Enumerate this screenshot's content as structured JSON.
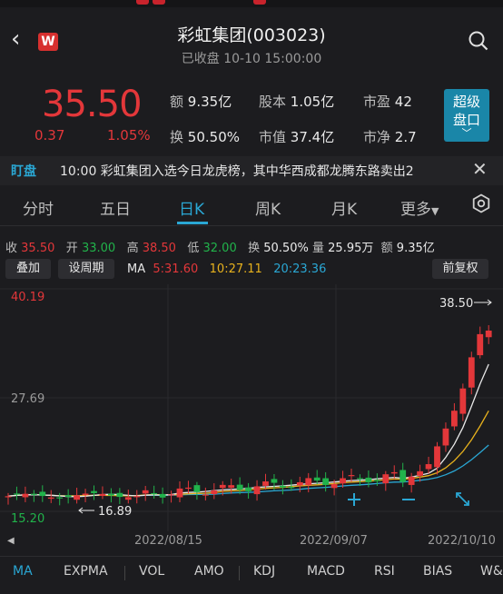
{
  "header": {
    "title": "彩虹集团(003023)",
    "subtitle": "已收盘 10-10 15:00:00",
    "logo_letter": "W"
  },
  "quote": {
    "price": "35.50",
    "change": "0.37",
    "change_pct": "1.05%",
    "stats": [
      {
        "label": "额",
        "value": "9.35亿"
      },
      {
        "label": "股本",
        "value": "1.05亿"
      },
      {
        "label": "市盈",
        "value": "42"
      },
      {
        "label": "换",
        "value": "50.50%"
      },
      {
        "label": "市值",
        "value": "37.4亿"
      },
      {
        "label": "市净",
        "value": "2.7"
      }
    ],
    "super_button": {
      "line1": "超级",
      "line2": "盘口",
      "chevron": "﹀"
    }
  },
  "news": {
    "tag": "盯盘",
    "text": "10:00 彩虹集团入选今日龙虎榜，其中华西成都龙腾东路卖出2"
  },
  "tabs": [
    "分时",
    "五日",
    "日K",
    "周K",
    "月K",
    "更多"
  ],
  "active_tab": "日K",
  "info_row": {
    "close_label": "收",
    "close": "35.50",
    "open_label": "开",
    "open": "33.00",
    "high_label": "高",
    "high": "38.50",
    "low_label": "低",
    "low": "32.00",
    "turnover_label": "换",
    "turnover": "50.50%",
    "volume_label": "量",
    "volume": "25.95万",
    "amount_label": "额",
    "amount": "9.35亿"
  },
  "controls": {
    "overlay": "叠加",
    "period": "设周期",
    "adjust": "前复权",
    "ma_label": "MA",
    "ma5": "5:31.60",
    "ma10": "10:27.11",
    "ma20": "20:23.36"
  },
  "chart_data": {
    "type": "candlestick",
    "y_ticks": [
      "40.19",
      "27.69",
      "15.20"
    ],
    "ylim": [
      15.2,
      40.19
    ],
    "high_marker": "38.50",
    "low_marker": "16.89",
    "x_labels": [
      "2022/08/15",
      "2022/09/07",
      "2022/10/10"
    ],
    "colors": {
      "up": "#e3373a",
      "down": "#21b34b",
      "ma5": "#e8e8e8",
      "ma10": "#e8b21d",
      "ma20": "#2aa7d4"
    }
  },
  "indicators": [
    "MA",
    "EXPMA",
    "VOL",
    "AMO",
    "KDJ",
    "MACD",
    "RSI",
    "BIAS",
    "W&R"
  ],
  "active_indicator": "MA"
}
